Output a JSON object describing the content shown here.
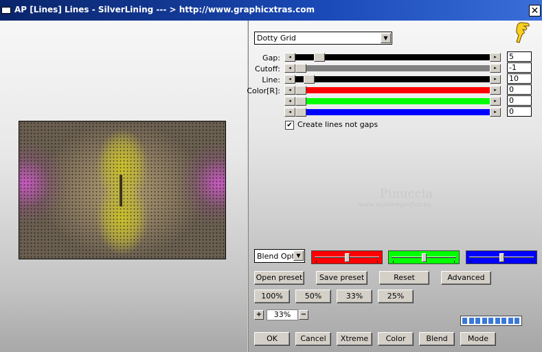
{
  "window": {
    "title": "AP [Lines]  Lines - SilverLining     --- > http://www.graphicxtras.com",
    "close_glyph": "✕"
  },
  "preset_select": {
    "value": "Dotty Grid",
    "arrow": "▼"
  },
  "sliders": [
    {
      "label": "Gap:",
      "value": "5",
      "track_color": "#000000",
      "thumb_fraction": 0.04
    },
    {
      "label": "Cutoff:",
      "value": "-1",
      "track_color": "#808080",
      "thumb_fraction": 0.0
    },
    {
      "label": "Line:",
      "value": "10",
      "track_color": "#000000",
      "thumb_fraction": 0.0
    },
    {
      "label": "Color[R]:",
      "value": "0",
      "track_color": "#ff0000",
      "thumb_fraction": 0.0
    },
    {
      "label": "",
      "value": "0",
      "track_color": "#00ff00",
      "thumb_fraction": 0.0
    },
    {
      "label": "",
      "value": "0",
      "track_color": "#0000ff",
      "thumb_fraction": 0.0
    }
  ],
  "checkbox": {
    "label": "Create lines not gaps",
    "checked": true,
    "mark": "✔"
  },
  "watermark": {
    "name": "Pinuccia",
    "site": "www.maidiregrafica.eu"
  },
  "blend_select": {
    "value": "Blend Optio",
    "arrow": "▼"
  },
  "color_sliders": [
    {
      "name": "red",
      "color": "#ff0000",
      "level": 0.48
    },
    {
      "name": "green",
      "color": "#00ff00",
      "level": 0.48
    },
    {
      "name": "blue",
      "color": "#0000ff",
      "level": 0.48
    }
  ],
  "buttons": {
    "open_preset": "Open preset",
    "save_preset": "Save preset",
    "reset": "Reset",
    "advanced": "Advanced",
    "zoom100": "100%",
    "zoom50": "50%",
    "zoom33": "33%",
    "zoom25": "25%",
    "ok": "OK",
    "cancel": "Cancel",
    "xtreme": "Xtreme",
    "color": "Color",
    "blend": "Blend",
    "mode": "Mode"
  },
  "zoom": {
    "plus": "+",
    "minus": "−",
    "value": "33%"
  },
  "progress": {
    "segments": 9
  },
  "arrows": {
    "left": "◂",
    "right": "▸"
  }
}
